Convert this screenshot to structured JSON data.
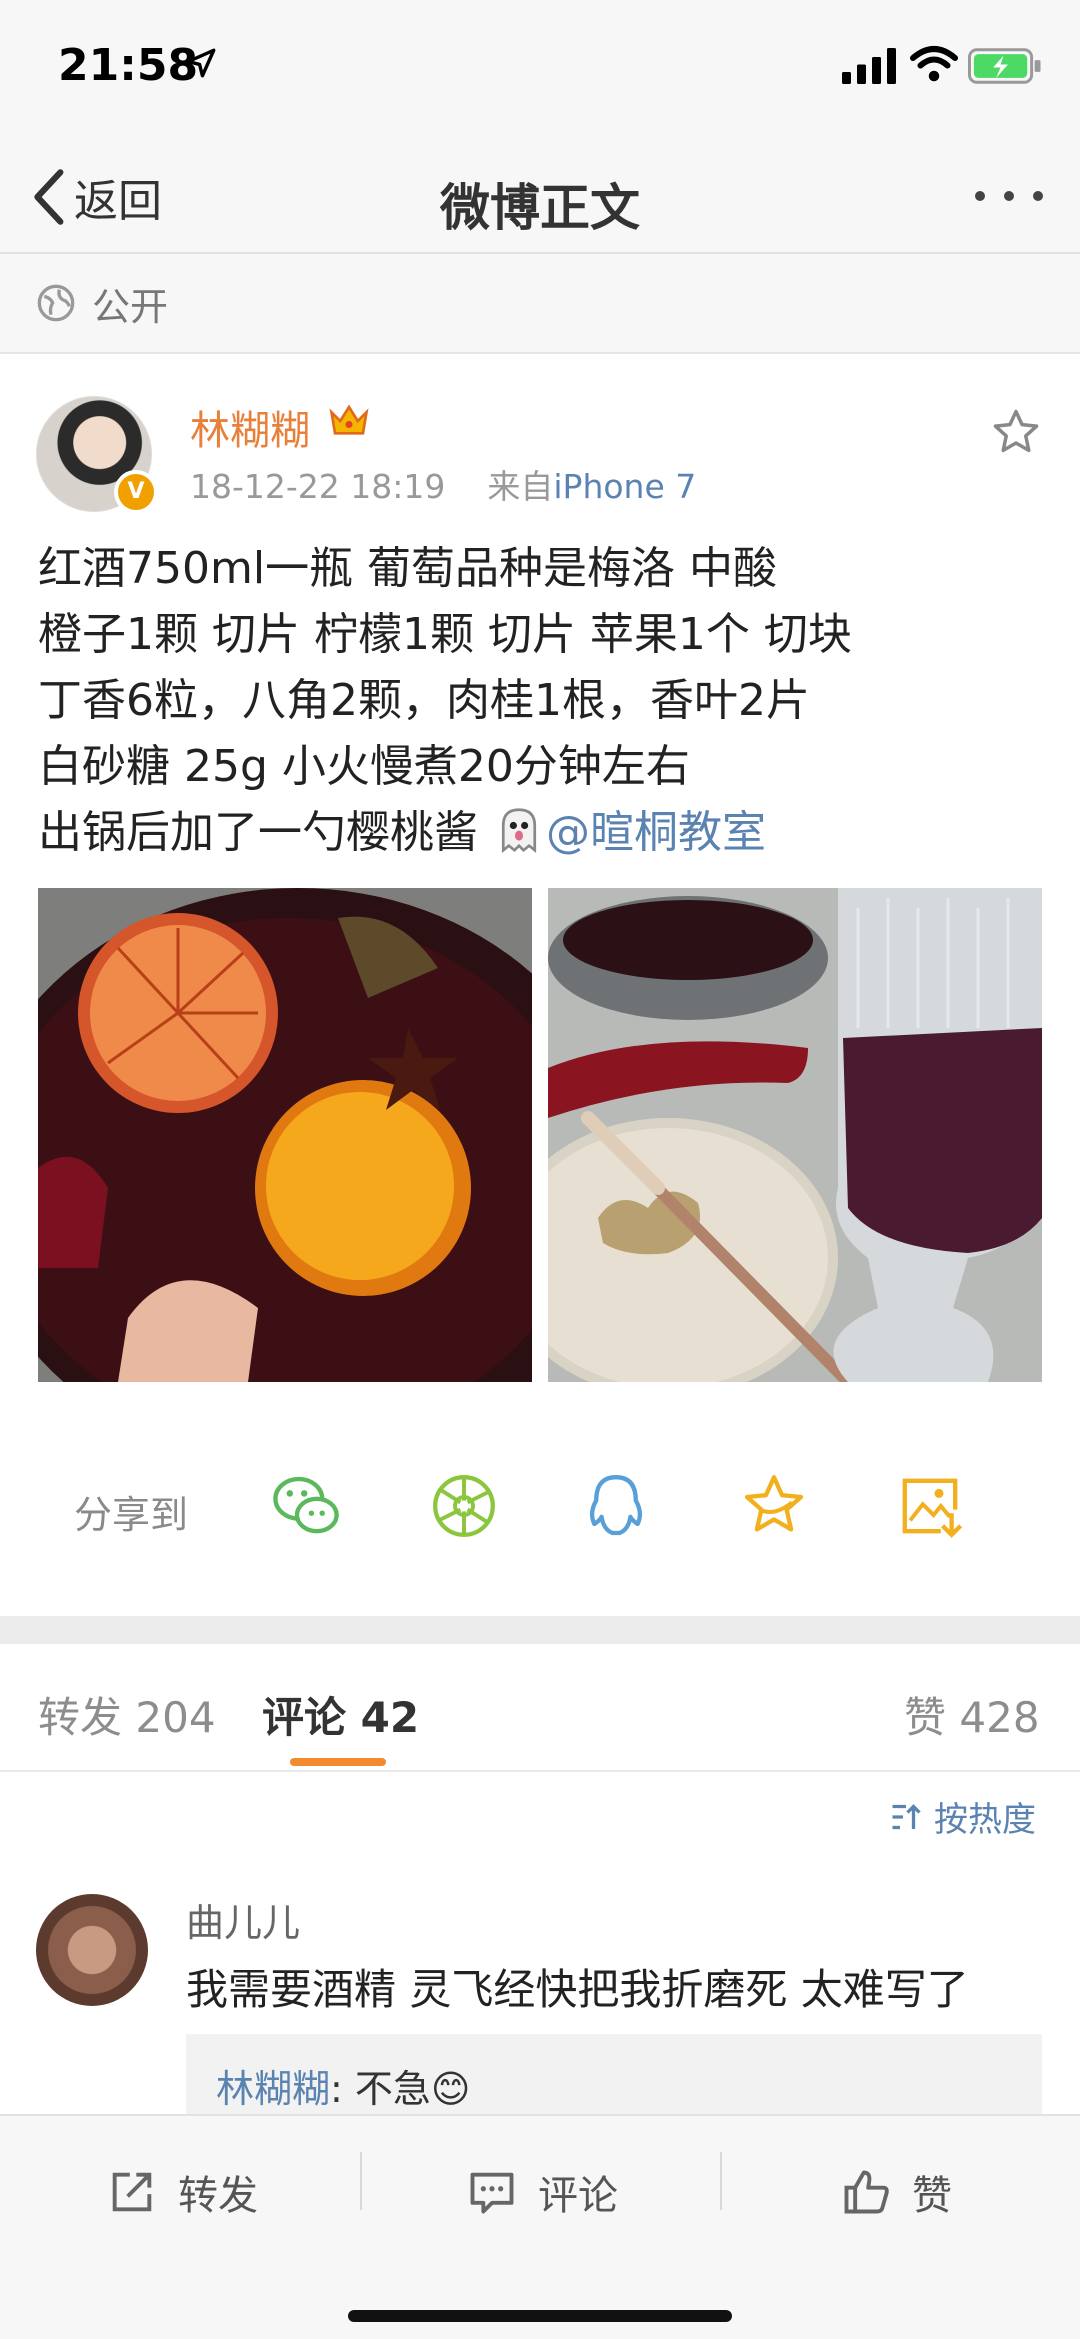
{
  "status_bar": {
    "time": "21:58"
  },
  "nav": {
    "back_label": "返回",
    "title": "微博正文"
  },
  "visibility": {
    "label": "公开"
  },
  "post": {
    "author": "林糊糊",
    "timestamp": "18-12-22 18:19",
    "source_prefix": "来自",
    "source": "iPhone 7",
    "lines": [
      "红酒750ml一瓶 葡萄品种是梅洛 中酸",
      "橙子1颗 切片 柠檬1颗 切片 苹果1个 切块",
      "丁香6粒，八角2颗，肉桂1根，香叶2片",
      "白砂糖 25g  小火慢煮20分钟左右",
      "出锅后加了一勺樱桃酱 "
    ],
    "mention": "@暄桐教室"
  },
  "share": {
    "label": "分享到"
  },
  "tabs": {
    "repost_label": "转发",
    "repost_count": "204",
    "comment_label": "评论",
    "comment_count": "42",
    "like_label": "赞",
    "like_count": "428"
  },
  "sort": {
    "label": "按热度"
  },
  "comment": {
    "name": "曲儿儿",
    "text": "我需要酒精 灵飞经快把我折磨死 太难写了",
    "reply_name": "林糊糊",
    "reply_text": ": 不急😊"
  },
  "toolbar": {
    "repost": "转发",
    "comment": "评论",
    "like": "赞"
  },
  "colors": {
    "accent": "#f28a2e",
    "link": "#5b83b2",
    "author": "#e8803a"
  }
}
